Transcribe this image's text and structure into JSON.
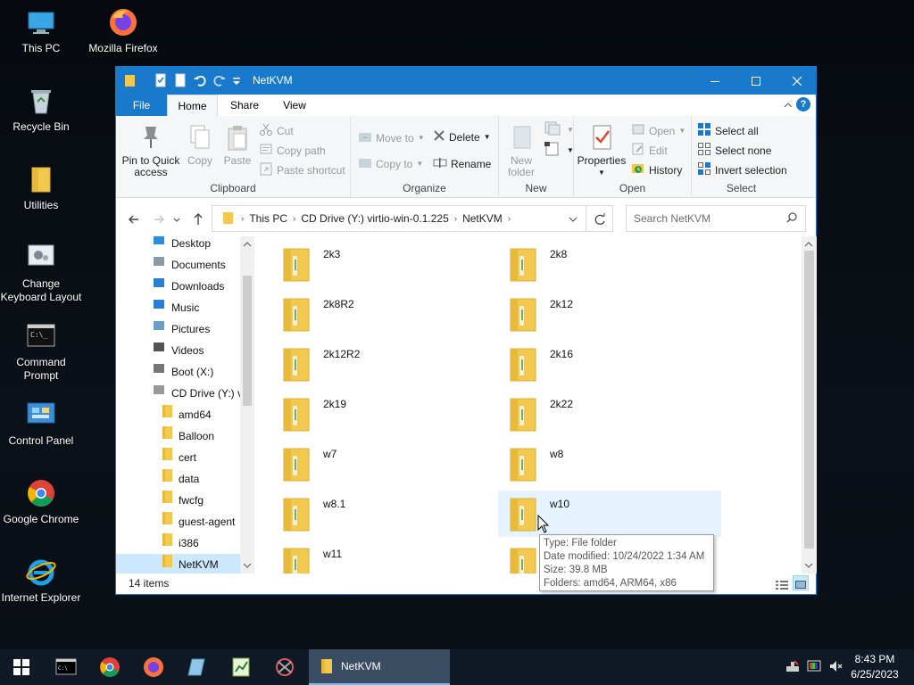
{
  "desktop": {
    "icons": [
      {
        "label": "This PC"
      },
      {
        "label": "Mozilla Firefox"
      },
      {
        "label": "Recycle Bin"
      },
      {
        "label": "Utilities"
      },
      {
        "label": "Change Keyboard Layout"
      },
      {
        "label": "Command Prompt"
      },
      {
        "label": "Control Panel"
      },
      {
        "label": "Google Chrome"
      },
      {
        "label": "Internet Explorer"
      }
    ]
  },
  "window": {
    "title": "NetKVM",
    "tabs": {
      "file": "File",
      "home": "Home",
      "share": "Share",
      "view": "View"
    },
    "help": "?",
    "ribbon": {
      "clipboard": {
        "label": "Clipboard",
        "pin": "Pin to Quick access",
        "copy": "Copy",
        "paste": "Paste",
        "cut": "Cut",
        "copy_path": "Copy path",
        "paste_shortcut": "Paste shortcut"
      },
      "organize": {
        "label": "Organize",
        "move_to": "Move to",
        "copy_to": "Copy to",
        "delete": "Delete",
        "rename": "Rename"
      },
      "new": {
        "label": "New",
        "new_folder": "New folder"
      },
      "open": {
        "label": "Open",
        "properties": "Properties",
        "open": "Open",
        "edit": "Edit",
        "history": "History"
      },
      "select": {
        "label": "Select",
        "select_all": "Select all",
        "select_none": "Select none",
        "invert": "Invert selection"
      }
    },
    "address": {
      "segments": [
        "This PC",
        "CD Drive (Y:) virtio-win-0.1.225",
        "NetKVM"
      ]
    },
    "search": {
      "placeholder": "Search NetKVM"
    },
    "nav": [
      {
        "label": "Desktop",
        "icon": "desktop-icon"
      },
      {
        "label": "Documents",
        "icon": "documents-icon"
      },
      {
        "label": "Downloads",
        "icon": "downloads-icon"
      },
      {
        "label": "Music",
        "icon": "music-icon"
      },
      {
        "label": "Pictures",
        "icon": "pictures-icon"
      },
      {
        "label": "Videos",
        "icon": "videos-icon"
      },
      {
        "label": "Boot (X:)",
        "icon": "drive-icon"
      },
      {
        "label": "CD Drive (Y:) vi",
        "icon": "cd-drive-icon"
      },
      {
        "label": "amd64",
        "icon": "folder-icon"
      },
      {
        "label": "Balloon",
        "icon": "folder-icon"
      },
      {
        "label": "cert",
        "icon": "folder-icon"
      },
      {
        "label": "data",
        "icon": "folder-icon"
      },
      {
        "label": "fwcfg",
        "icon": "folder-icon"
      },
      {
        "label": "guest-agent",
        "icon": "folder-icon"
      },
      {
        "label": "i386",
        "icon": "folder-icon"
      },
      {
        "label": "NetKVM",
        "icon": "folder-icon"
      }
    ],
    "folders": [
      "2k3",
      "2k8",
      "2k8R2",
      "2k12",
      "2k12R2",
      "2k16",
      "2k19",
      "2k22",
      "w7",
      "w8",
      "w8.1",
      "w10",
      "w11",
      ""
    ],
    "tooltip": {
      "type": "Type: File folder",
      "modified": "Date modified: 10/24/2022 1:34 AM",
      "size": "Size: 39.8 MB",
      "folders": "Folders: amd64, ARM64, x86"
    },
    "status": "14 items"
  },
  "taskbar": {
    "active_window": "NetKVM",
    "time": "8:43 PM",
    "date": "6/25/2023"
  },
  "colors": {
    "accent": "#1979ca",
    "folder": "#f2c94c",
    "selection": "#cce8ff"
  }
}
